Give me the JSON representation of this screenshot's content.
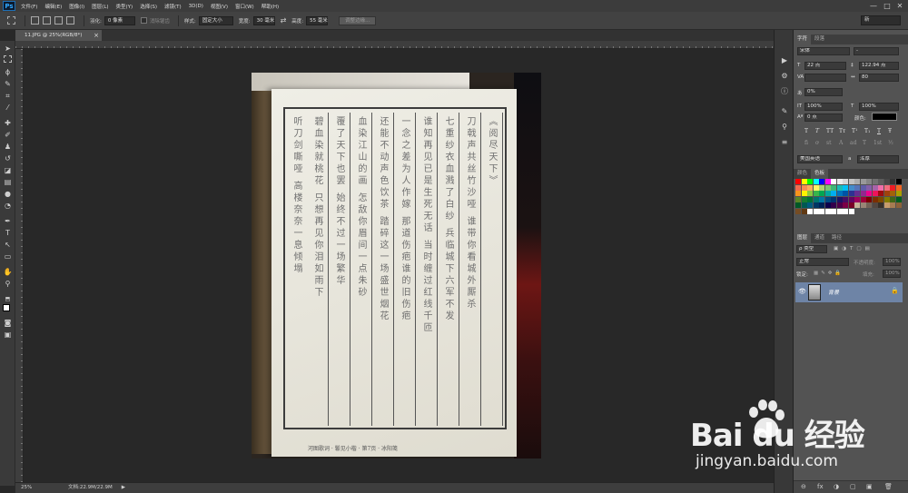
{
  "app": {
    "logo": "Ps"
  },
  "menubar": {
    "items": [
      "文件(F)",
      "编辑(E)",
      "图像(I)",
      "图层(L)",
      "类型(Y)",
      "选择(S)",
      "滤镜(T)",
      "3D(D)",
      "视图(V)",
      "窗口(W)",
      "帮助(H)"
    ],
    "controls": [
      "—",
      "□",
      "✕"
    ]
  },
  "options_bar": {
    "feather_label": "羽化:",
    "feather_value": "0 像素",
    "antialias_label": "消除锯齿",
    "style_label": "样式:",
    "style_value": "固定大小",
    "width_label": "宽度:",
    "width_value": "30 毫米",
    "height_label": "高度:",
    "height_value": "55 毫米",
    "refine_edge_label": "调整边缘...",
    "workspace_value": "新"
  },
  "document": {
    "tab_title": "11.JPG @ 25%(RGB/8*)",
    "tab_close": "×",
    "zoom": "25%",
    "doc_info": "文档:22.9M/22.9M",
    "status_arrow": "▶"
  },
  "book": {
    "columns": [
      "《阅尽天下》",
      "刀戟声共丝竹沙哑 谁带你看城外厮杀",
      "七重纱衣血溅了白纱 兵临城下六军不发",
      "谁知再见已是生死无话 当时缠过红线千匝",
      "一念之差为人作嫁 那道伤疤谁的旧伤疤",
      "还能不动声色饮茶 踏碎这一场盛世烟花",
      "血染江山的画 怎敌你眉间一点朱砂",
      "覆了天下也罢 始终不过一场繁华",
      "碧血染就桃花 只想再见你泪如雨下",
      "听刀剑嘶哑 高楼奈奈一息倾塌"
    ],
    "footer": "河图歌词 · 鬈见小楷 · 第7页 · 冰阳笺"
  },
  "character_panel": {
    "tabs": [
      "字符",
      "段落"
    ],
    "font_family": "宋体",
    "font_style": "-",
    "font_size": "22 点",
    "leading": "122.94 点",
    "kerning_label": "VA",
    "tracking": "80",
    "scale_percent": "0%",
    "vertical_scale": "100%",
    "horizontal_scale": "100%",
    "baseline_shift": "0 点",
    "color_label": "颜色:",
    "color_value": "#000000",
    "type_buttons": [
      "T",
      "T",
      "TT",
      "Tт",
      "T¹",
      "T₁",
      "T",
      "Ŧ"
    ],
    "ot_buttons": [
      "fi",
      "ơ",
      "st",
      "A",
      "ad",
      "T",
      "1st",
      "½"
    ],
    "language": "美国英语",
    "aa_label": "a",
    "antialias": "浑厚"
  },
  "swatches_panel": {
    "tabs": [
      "颜色",
      "色板"
    ],
    "colors": [
      "#ff0000",
      "#ffff00",
      "#00ff00",
      "#00ffff",
      "#0000ff",
      "#ff00ff",
      "#ffffff",
      "#ebebeb",
      "#d6d6d6",
      "#c2c2c2",
      "#adadad",
      "#999999",
      "#858585",
      "#707070",
      "#5c5c5c",
      "#474747",
      "#333333",
      "#000000",
      "#f26c4f",
      "#f68e55",
      "#fbaf5c",
      "#fff467",
      "#acd372",
      "#7dc473",
      "#3cb878",
      "#1cbbb4",
      "#00bff3",
      "#438ccb",
      "#5574b9",
      "#605ca8",
      "#855fa8",
      "#a763a9",
      "#ef6ea8",
      "#f16d7e",
      "#ed1c24",
      "#f26522",
      "#f7941d",
      "#fff200",
      "#8dc63f",
      "#39b54a",
      "#00a651",
      "#00a99d",
      "#00aeef",
      "#0072bc",
      "#0054a6",
      "#2e3192",
      "#662d91",
      "#92278f",
      "#ec008c",
      "#ed145b",
      "#9e0b0f",
      "#a0410d",
      "#a3620a",
      "#aba000",
      "#598527",
      "#197b30",
      "#007236",
      "#00746b",
      "#0076a3",
      "#004a80",
      "#003471",
      "#1b1464",
      "#440e62",
      "#630460",
      "#9e005d",
      "#9e0039",
      "#790000",
      "#7b2e00",
      "#7d4900",
      "#827b00",
      "#406618",
      "#005e20",
      "#005826",
      "#005952",
      "#005b7f",
      "#003663",
      "#002157",
      "#0d004c",
      "#32004b",
      "#4b0049",
      "#7b0046",
      "#7a0026",
      "#c7b299",
      "#998675",
      "#736357",
      "#534741",
      "#37302a",
      "#c69c6d",
      "#a67c52",
      "#8c6239",
      "#754c24",
      "#603913",
      "#ffffff",
      "#ffffff",
      "#ffffff",
      "#ffffff",
      "#ffffff",
      "#ffffff",
      "#ffffff",
      "#ffffff"
    ]
  },
  "layers_panel": {
    "tabs": [
      "图层",
      "通道",
      "路径"
    ],
    "kind_filter": "ρ 类型",
    "blend_mode": "正常",
    "opacity_label": "不透明度:",
    "opacity_value": "100%",
    "lock_label": "锁定:",
    "fill_label": "填充:",
    "fill_value": "100%",
    "layer_name": "背景",
    "footer_icons": [
      "⊖",
      "fx",
      "◑",
      "▢",
      "▣",
      "🗑"
    ]
  },
  "watermark": {
    "logo_text": "Bai du 经验",
    "url": "jingyan.baidu.com"
  }
}
